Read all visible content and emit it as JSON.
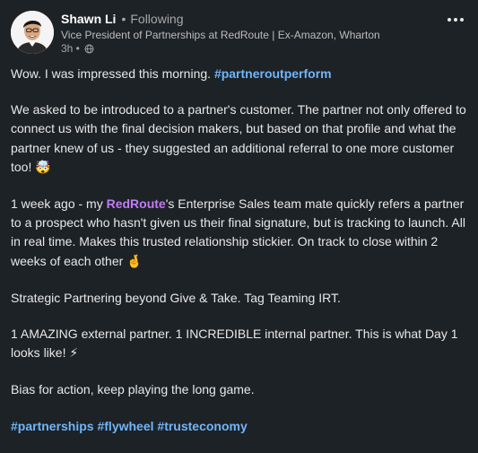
{
  "author": {
    "name": "Shawn Li",
    "separator": "•",
    "follow_status": "Following",
    "headline": "Vice President of Partnerships at RedRoute | Ex-Amazon, Wharton",
    "time": "3h •",
    "visibility_icon": "globe-icon"
  },
  "menu": {
    "icon": "more-horizontal-icon"
  },
  "post": {
    "p1_text": "Wow. I was impressed this morning. ",
    "p1_tag": "#partneroutperform",
    "p2_text": "We asked to be introduced to a partner's customer. The partner not only offered to connect us with the final decision makers, but based on that profile and what the partner knew of us - they suggested an additional referral to one more customer too! ",
    "p2_emoji": "🤯",
    "p3_prefix": "1 week ago - my ",
    "p3_mention": "RedRoute",
    "p3_text": "'s Enterprise Sales team mate quickly refers a partner to a prospect who hasn't given us their final signature, but is tracking to launch. All in real time. Makes this trusted relationship stickier. On track to close within 2 weeks of each other ",
    "p3_emoji": "🤞",
    "p4_text": "Strategic Partnering beyond Give & Take. Tag Teaming IRT.",
    "p5_text": "1 AMAZING external partner. 1 INCREDIBLE internal partner. This is what Day 1 looks like! ",
    "p5_emoji": "⚡",
    "p6_text": "Bias for action, keep playing the long game.",
    "tags": [
      "#partnerships",
      "#flywheel",
      "#trusteconomy"
    ]
  },
  "colors": {
    "background": "#1d2226",
    "hashtag": "#70b5f9",
    "mention": "#c37bf5",
    "text": "#e8e8e8"
  }
}
